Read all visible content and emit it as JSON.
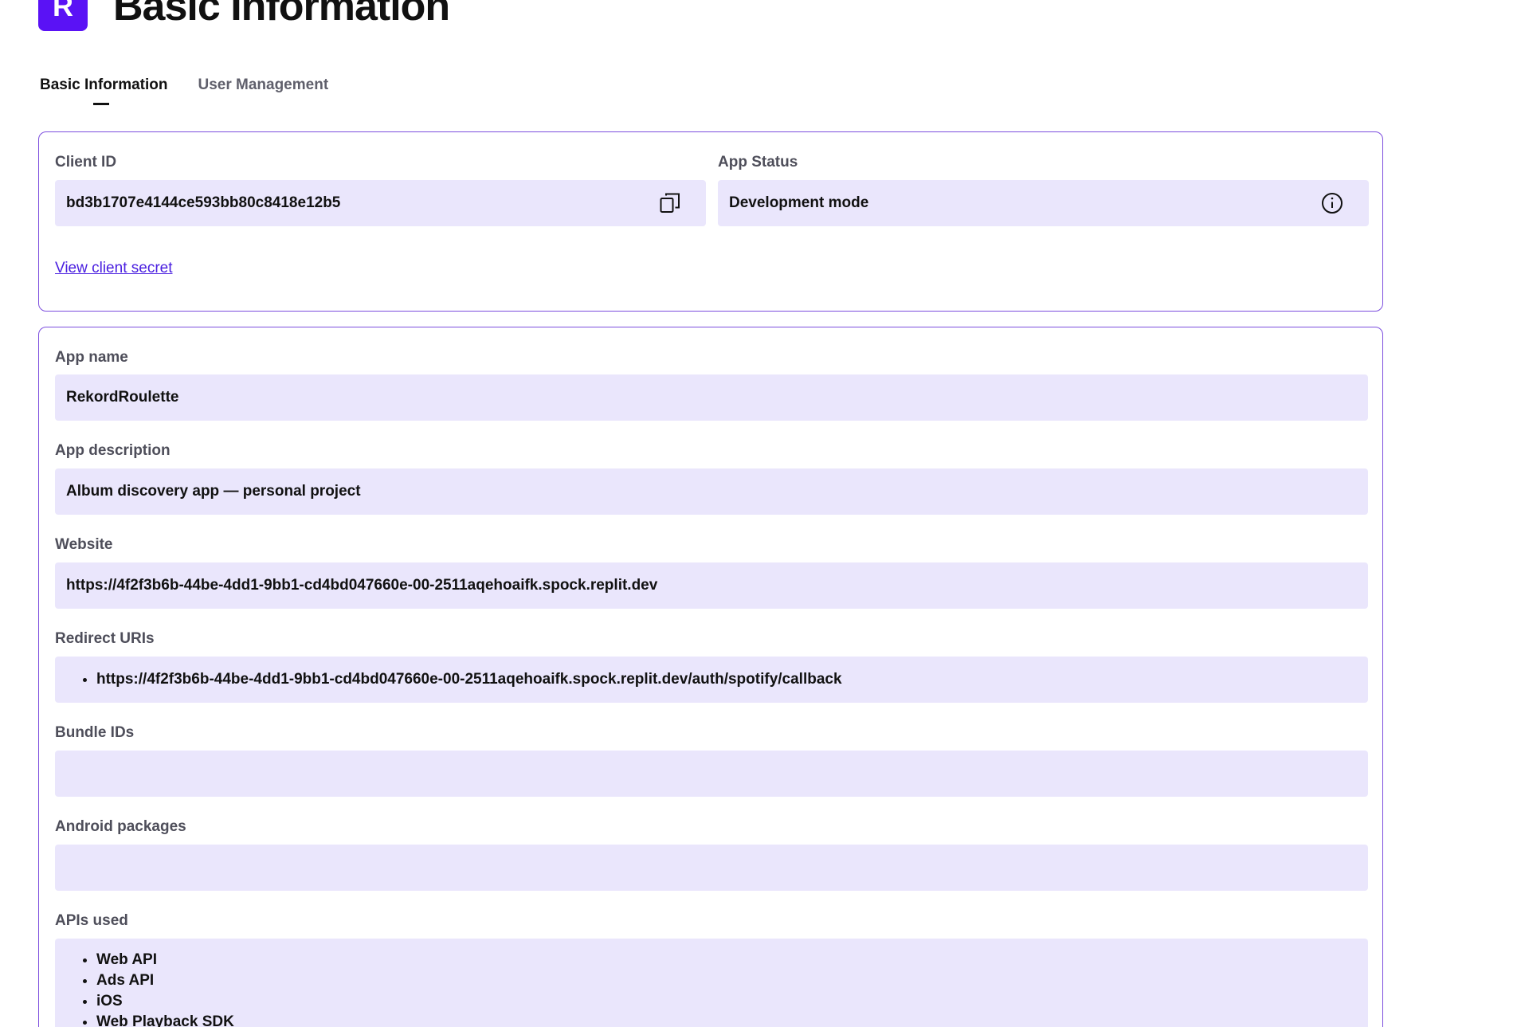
{
  "header": {
    "logo_letter": "R",
    "title": "Basic Information"
  },
  "tabs": [
    {
      "label": "Basic Information",
      "active": true
    },
    {
      "label": "User Management",
      "active": false
    }
  ],
  "credentials": {
    "client_id_label": "Client ID",
    "client_id_value": "bd3b1707e4144ce593bb80c8418e12b5",
    "copy_icon": "copy-icon",
    "app_status_label": "App Status",
    "app_status_value": "Development mode",
    "info_icon": "info-icon",
    "view_secret_link": "View client secret"
  },
  "details": {
    "app_name": {
      "label": "App name",
      "value": "RekordRoulette"
    },
    "app_description": {
      "label": "App description",
      "value": "Album discovery app — personal project"
    },
    "website": {
      "label": "Website",
      "value": "https://4f2f3b6b-44be-4dd1-9bb1-cd4bd047660e-00-2511aqehoaifk.spock.replit.dev"
    },
    "redirect_uris": {
      "label": "Redirect URIs",
      "items": [
        "https://4f2f3b6b-44be-4dd1-9bb1-cd4bd047660e-00-2511aqehoaifk.spock.replit.dev/auth/spotify/callback"
      ]
    },
    "bundle_ids": {
      "label": "Bundle IDs",
      "value": ""
    },
    "android_packages": {
      "label": "Android packages",
      "value": ""
    },
    "apis_used": {
      "label": "APIs used",
      "items": [
        "Web API",
        "Ads API",
        "iOS",
        "Web Playback SDK"
      ]
    }
  },
  "colors": {
    "brand": "#5a12f5",
    "card_border": "#7c4dde",
    "field_bg": "#eae6fc",
    "link": "#4a1fe0"
  }
}
